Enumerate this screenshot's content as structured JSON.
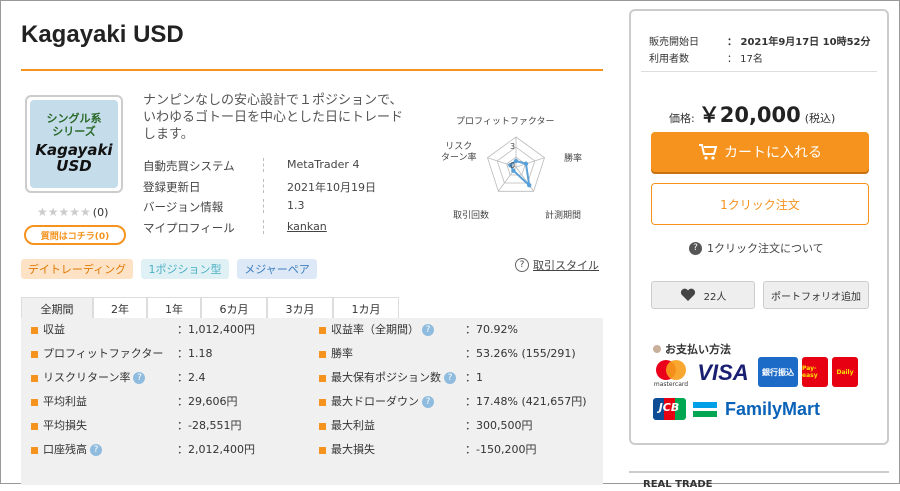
{
  "product": {
    "title": "Kagayaki USD",
    "logo_lines": [
      "シングル系",
      "シリーズ",
      "Kagayaki",
      "USD"
    ],
    "rating_stars": "★★★★★",
    "rating_count": "(0)",
    "question_button": "質問はコチラ(0)",
    "description": "ナンピンなしの安心設計で１ポジションで、いわゆるゴトー日を中心とした日にトレードします。",
    "info": [
      {
        "label": "自動売買システム",
        "value": "MetaTrader 4"
      },
      {
        "label": "登録更新日",
        "value": "2021年10月19日"
      },
      {
        "label": "バージョン情報",
        "value": "1.3"
      },
      {
        "label": "マイプロフィール",
        "value": "kankan"
      }
    ],
    "tags": [
      "デイトレーディング",
      "1ポジション型",
      "メジャーペア"
    ],
    "risk_style_label": "取引スタイル",
    "help_glyph": "?"
  },
  "radar": {
    "axes": [
      "プロフィットファクター",
      "勝率",
      "計測期間",
      "取引回数",
      "リスクリターン率"
    ],
    "risk_label_line1": "リスク",
    "risk_label_line2": "ターン率",
    "scale_max_label": "3",
    "scale_min_label": "0",
    "values": [
      0.2,
      0.35,
      0.75,
      0.15,
      0.2
    ],
    "color": "#5aa0d8"
  },
  "tabs": [
    "全期間",
    "2年",
    "1年",
    "6カ月",
    "3カ月",
    "1カ月"
  ],
  "stats": {
    "left": [
      {
        "label": "収益",
        "value": "：1,012,400円",
        "help": false
      },
      {
        "label": "プロフィットファクター",
        "value": "：1.18",
        "help": false
      },
      {
        "label": "リスクリターン率",
        "value": "：2.4",
        "help": true
      },
      {
        "label": "平均利益",
        "value": "：29,606円",
        "help": false
      },
      {
        "label": "平均損失",
        "value": "：-28,551円",
        "help": false
      },
      {
        "label": "口座残高",
        "value": "：2,012,400円",
        "help": true
      }
    ],
    "right": [
      {
        "label": "収益率（全期間）",
        "value": "：70.92%",
        "help": true
      },
      {
        "label": "勝率",
        "value": "：53.26% (155/291)",
        "help": false
      },
      {
        "label": "最大保有ポジション数",
        "value": "：1",
        "help": true
      },
      {
        "label": "最大ドローダウン",
        "value": "：17.48% (421,657円)",
        "help": true
      },
      {
        "label": "最大利益",
        "value": "：300,500円",
        "help": false
      },
      {
        "label": "最大損失",
        "value": "：-150,200円",
        "help": false
      }
    ]
  },
  "sidebar": {
    "sale_start_label": "販売開始日",
    "sale_start_value": "：  2021年9月17日 10時52分",
    "users_label": "利用者数",
    "users_value": "：  17名",
    "price_label": "価格:",
    "price_value": "￥20,000",
    "price_note": "(税込)",
    "cart_button": "カートに入れる",
    "oneclick_button": "1クリック注文",
    "oneclick_about": "1クリック注文について",
    "fav_count": "22人",
    "portfolio_button": "ポートフォリオ追加",
    "payment_title": "お支払い方法",
    "payment_logos": [
      "mastercard",
      "VISA",
      "銀行振込",
      "Pay-easy",
      "Daily",
      "JCB",
      "FamilyMart"
    ],
    "real_trade": "REAL TRADE"
  },
  "colors": {
    "accent": "#f5931e",
    "help": "#8fbcde"
  }
}
